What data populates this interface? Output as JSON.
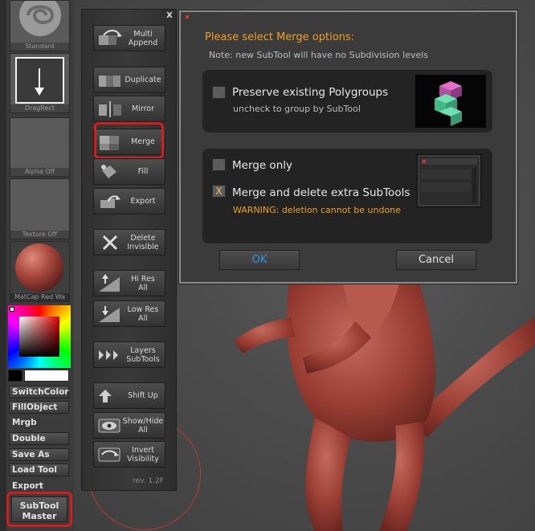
{
  "left_tray": {
    "thumbs": [
      {
        "caption": "Standard"
      },
      {
        "caption": "DragRect"
      },
      {
        "caption": "Alpha Off"
      },
      {
        "caption": "Texture Off"
      },
      {
        "caption": "MatCap Red Wa"
      }
    ],
    "buttons": [
      {
        "label": "SwitchColor"
      },
      {
        "label": "FillObject"
      },
      {
        "label": "Mrgb"
      },
      {
        "label": "Double"
      },
      {
        "label": "Save As"
      },
      {
        "label": "Load Tool"
      },
      {
        "label": "Export"
      }
    ],
    "subtool_master_label": "SubTool\nMaster"
  },
  "subtool_master_panel": {
    "close_label": "X",
    "buttons": [
      {
        "label": "Multi\nAppend",
        "icon": "multi-append-icon"
      },
      {
        "label": "Duplicate",
        "icon": "duplicate-icon"
      },
      {
        "label": "Mirror",
        "icon": "mirror-icon"
      },
      {
        "label": "Merge",
        "icon": "merge-icon"
      },
      {
        "label": "Fill",
        "icon": "fill-bucket-icon"
      },
      {
        "label": "Export",
        "icon": "export-icon"
      },
      {
        "label": "Delete\nInvisible",
        "icon": "delete-icon"
      },
      {
        "label": "Hi Res\nAll",
        "icon": "hi-res-icon"
      },
      {
        "label": "Low Res\nAll",
        "icon": "low-res-icon"
      },
      {
        "label": "Layers\nSubTools",
        "icon": "layers-icon"
      },
      {
        "label": "Shift Up",
        "icon": "shift-up-icon"
      },
      {
        "label": "Show/Hide\nAll",
        "icon": "show-hide-icon"
      },
      {
        "label": "Invert\nVisibility",
        "icon": "invert-visibility-icon"
      }
    ],
    "revision": "rev. 1.2F"
  },
  "dialog": {
    "title": "Please select Merge options:",
    "note": "Note: new SubTool will have no Subdivision levels",
    "options": {
      "preserve_polygroups": {
        "label": "Preserve existing Polygroups",
        "sublabel": "uncheck to group by SubTool",
        "checked": false
      },
      "merge_only": {
        "label": "Merge only",
        "checked": false
      },
      "merge_delete": {
        "label": "Merge and delete extra SubTools",
        "warning": "WARNING: deletion cannot be undone",
        "checked": true,
        "check_mark": "X"
      }
    },
    "ok_label": "OK",
    "cancel_label": "Cancel"
  },
  "colors": {
    "accent_orange": "#f0a020",
    "ok_blue": "#3a8ee6",
    "highlight_red": "#d21e1e",
    "model_red": "#a8483e"
  }
}
